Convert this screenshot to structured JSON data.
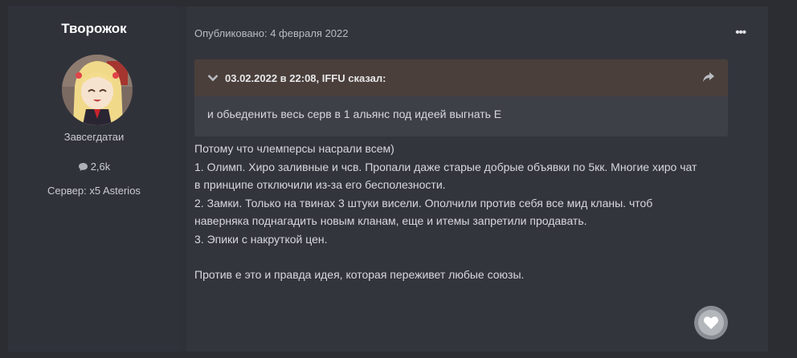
{
  "author": {
    "name": "Творожок",
    "rank": "Завсегдатаи",
    "reactions_count": "2,6k",
    "server": "Сервер: x5 Asterios"
  },
  "post": {
    "published": "Опубликовано: 4 февраля 2022",
    "menu_label": "•••",
    "quote": {
      "citation": "03.02.2022 в 22:08, IFFU сказал:",
      "text": "и обьеденить весь серв в 1 альянс под идеей выгнать Е"
    },
    "lines": [
      "Потому что члемперсы насрали всем)",
      "1. Олимп. Хиро заливные и чсв. Пропали даже старые добрые объявки по 5кк. Многие хиро чат",
      "в принципе отключили из-за его бесполезности.",
      "2. Замки. Только на твинах 3 штуки висели. Ополчили против себя все мид кланы. чтоб",
      "наверняка поднагадить новым кланам, еще и итемы запретили продавать.",
      "3. Эпики с накруткой цен."
    ],
    "closing": "Против е это и правда идея, которая переживет любые союзы."
  },
  "icons": {
    "reactions": "comment-icon",
    "quote_toggle": "chevron-down-icon",
    "share": "share-arrow-icon",
    "like": "heart-icon"
  }
}
